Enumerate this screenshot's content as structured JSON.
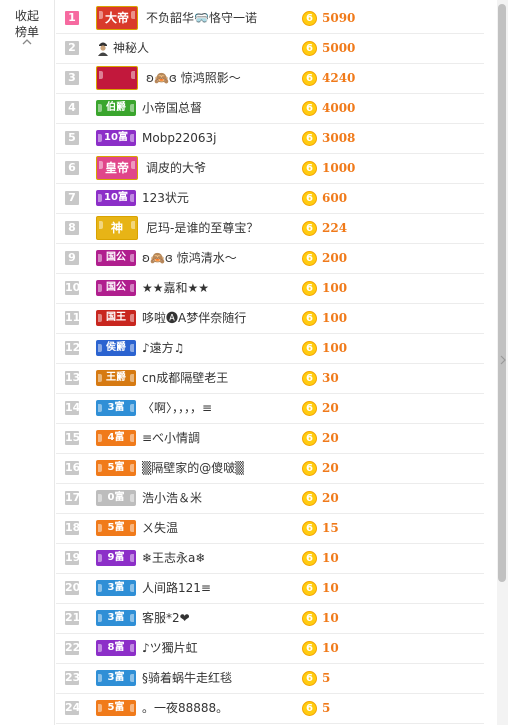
{
  "sidebar": {
    "collapse_label": "收起榜单",
    "collapse_icon": "chevron-up-icon"
  },
  "coin_glyph": "6",
  "colors": {
    "score": "#f07a1a",
    "rank_top": "#f66aa0",
    "rank_default": "#c8c8c8",
    "coin": "#ffcc11"
  },
  "rows": [
    {
      "rank": "1",
      "badge": "大帝",
      "badge_color": "#d93a2b",
      "big": true,
      "name": "不负韶华🥽恪守一诺",
      "score": "5090"
    },
    {
      "rank": "2",
      "badge": "",
      "badge_color": "",
      "big": false,
      "mystery": true,
      "name": "神秘人",
      "score": "5000"
    },
    {
      "rank": "3",
      "badge": "",
      "badge_color": "#c2183c",
      "big": true,
      "name": "ʚ🙈ɞ 惊鸿照影～",
      "score": "4240"
    },
    {
      "rank": "4",
      "badge": "伯爵",
      "badge_color": "#3aa52d",
      "big": false,
      "name": "小帝国总督",
      "score": "4000"
    },
    {
      "rank": "5",
      "badge": "10富",
      "badge_color": "#8c2fc8",
      "big": false,
      "name": "Mobp22063j",
      "score": "3008"
    },
    {
      "rank": "6",
      "badge": "皇帝",
      "badge_color": "#e0468a",
      "big": true,
      "name": "调皮的大爷",
      "score": "1000"
    },
    {
      "rank": "7",
      "badge": "10富",
      "badge_color": "#8c2fc8",
      "big": false,
      "name": "123状元",
      "score": "600"
    },
    {
      "rank": "8",
      "badge": "神",
      "badge_color": "#e7b416",
      "big": true,
      "name": "尼玛-是谁的至尊宝？",
      "score": "224"
    },
    {
      "rank": "9",
      "badge": "国公",
      "badge_color": "#b01f8e",
      "big": false,
      "name": "ʚ🙈ɞ 惊鸿清水～",
      "score": "200"
    },
    {
      "rank": "10",
      "badge": "国公",
      "badge_color": "#b01f8e",
      "big": false,
      "name": "★★嘉和★★",
      "score": "100"
    },
    {
      "rank": "11",
      "badge": "国王",
      "badge_color": "#c8261f",
      "big": false,
      "name": "哆啦🅐A梦伴奈随行",
      "score": "100"
    },
    {
      "rank": "12",
      "badge": "侯爵",
      "badge_color": "#2b63d0",
      "big": false,
      "name": "♪遠方♫",
      "score": "100"
    },
    {
      "rank": "13",
      "badge": "王爵",
      "badge_color": "#d67a12",
      "big": false,
      "name": "cn成都隔壁老王",
      "score": "30"
    },
    {
      "rank": "14",
      "badge": "3富",
      "badge_color": "#2f8fd6",
      "big": false,
      "name": "〈啊〉，，，，≡",
      "score": "20"
    },
    {
      "rank": "15",
      "badge": "4富",
      "badge_color": "#f07a1a",
      "big": false,
      "name": "≡べ小情調",
      "score": "20"
    },
    {
      "rank": "16",
      "badge": "5富",
      "badge_color": "#f07a1a",
      "big": false,
      "name": "▒隔壁家的@傻啵▒",
      "score": "20"
    },
    {
      "rank": "17",
      "badge": "0富",
      "badge_color": "#bdbdbd",
      "big": false,
      "name": "浩小浩＆米",
      "score": "20"
    },
    {
      "rank": "18",
      "badge": "5富",
      "badge_color": "#f07a1a",
      "big": false,
      "name": "ㄨ失温",
      "score": "15"
    },
    {
      "rank": "19",
      "badge": "9富",
      "badge_color": "#8c2fc8",
      "big": false,
      "name": "❄王志永a❄",
      "score": "10"
    },
    {
      "rank": "20",
      "badge": "3富",
      "badge_color": "#2f8fd6",
      "big": false,
      "name": "人间路121≡",
      "score": "10"
    },
    {
      "rank": "21",
      "badge": "3富",
      "badge_color": "#2f8fd6",
      "big": false,
      "name": "客服*2❤",
      "score": "10"
    },
    {
      "rank": "22",
      "badge": "8富",
      "badge_color": "#8c2fc8",
      "big": false,
      "name": "♪ツ獨片虹",
      "score": "10"
    },
    {
      "rank": "23",
      "badge": "3富",
      "badge_color": "#2f8fd6",
      "big": false,
      "name": "§骑着蜗牛走红毯",
      "score": "5"
    },
    {
      "rank": "24",
      "badge": "5富",
      "badge_color": "#f07a1a",
      "big": false,
      "name": "。一夜88888。",
      "score": "5"
    }
  ]
}
